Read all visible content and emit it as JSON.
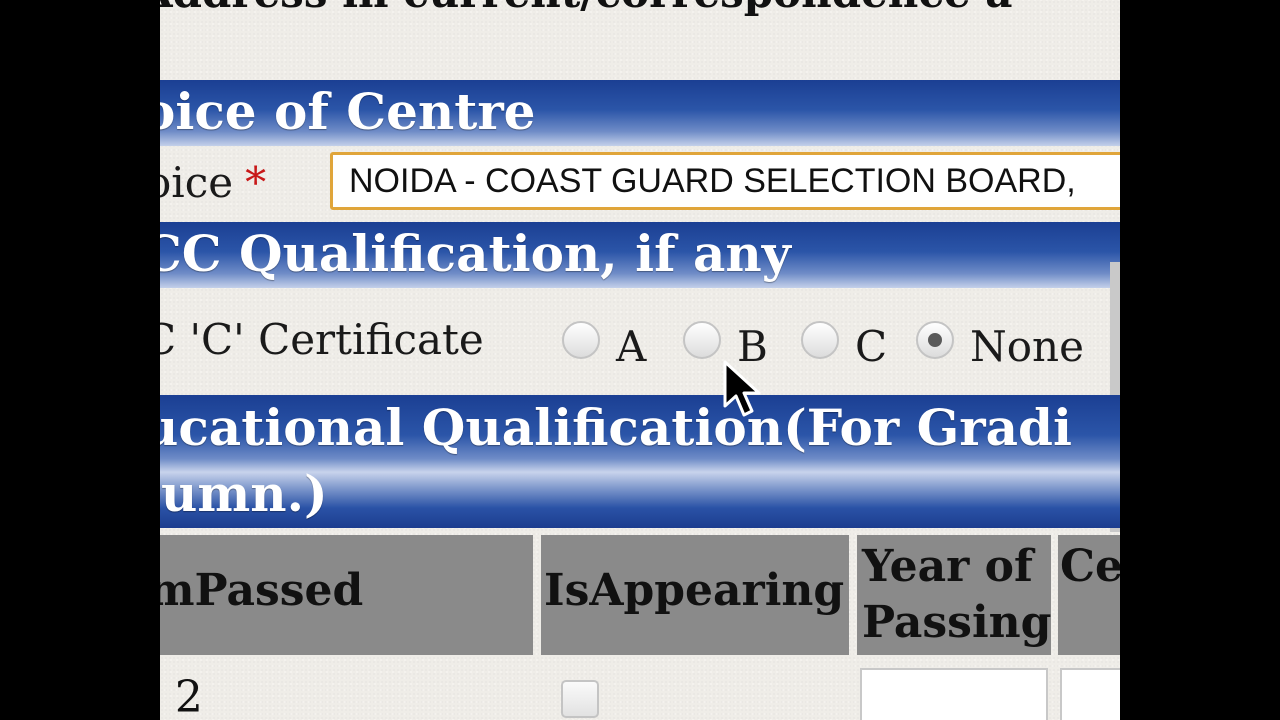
{
  "header": {
    "clipped_text": "Address in current/correspondence a"
  },
  "centre_section": {
    "title": "oice of Centre",
    "choice_label": "oice",
    "required_mark": "*",
    "selected_value": "NOIDA - COAST GUARD SELECTION BOARD, "
  },
  "ncc_section": {
    "title": "CC Qualification, if any",
    "certificate_label": "C 'C' Certificate",
    "options": [
      {
        "label": "A",
        "checked": false
      },
      {
        "label": "B",
        "checked": false
      },
      {
        "label": "C",
        "checked": false
      },
      {
        "label": "None",
        "checked": true
      }
    ]
  },
  "education_section": {
    "title_line1": "ucational Qualification(For Gradi",
    "title_line2": "lumn.)"
  },
  "table": {
    "headers": {
      "exam_passed": "mPassed",
      "is_appearing": "IsAppearing",
      "year_of_passing": "Year of Passing",
      "certificate_no": "Ce No"
    },
    "rows": [
      {
        "exam": "- 2"
      }
    ]
  },
  "colors": {
    "band_blue": "#2b55a8",
    "required_red": "#c81818",
    "select_border": "#e0a53a",
    "header_gray": "#8a8a8a"
  },
  "icons": {
    "cursor": "mouse-pointer-icon"
  }
}
